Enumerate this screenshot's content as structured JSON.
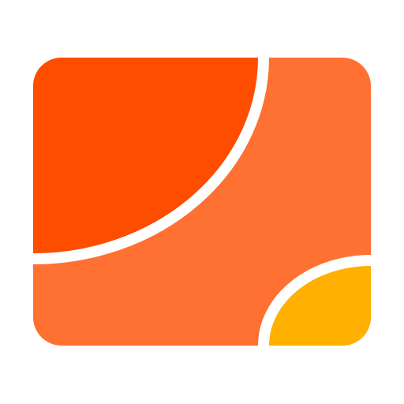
{
  "icon": {
    "name": "orange-tile-app-icon",
    "colors": {
      "background": "#ffffff",
      "tile": "#FF7033",
      "top_left_quadrant": "#FF4D00",
      "bottom_right_quadrant": "#FFB000",
      "divider": "#ffffff"
    }
  }
}
